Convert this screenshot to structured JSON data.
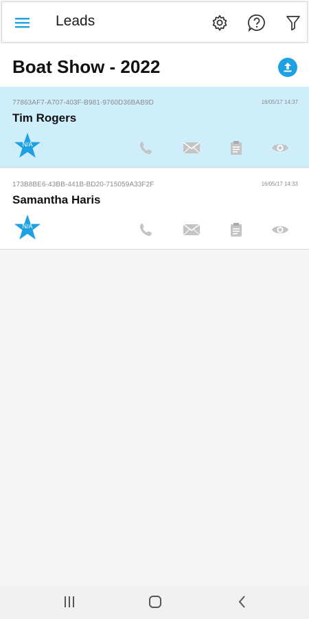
{
  "appbar": {
    "title": "Leads",
    "icons": {
      "menu": "hamburger-menu-icon",
      "settings": "gear-icon",
      "help": "question-bubble-icon",
      "filter": "funnel-icon"
    }
  },
  "event": {
    "title": "Boat Show - 2022",
    "upload_icon": "upload-icon"
  },
  "leads": [
    {
      "id": "77863AF7-A707-403F-B981-9760D36BAB9D",
      "timestamp": "16/05/17 14:37",
      "name": "Tim Rogers",
      "rating": "N/A",
      "selected": true
    },
    {
      "id": "173B8BE6-43BB-441B-BD20-715059A33F2F",
      "timestamp": "16/05/17 14:33",
      "name": "Samantha Haris",
      "rating": "N/A",
      "selected": false
    }
  ],
  "colors": {
    "accent": "#1da1e2",
    "selected_row": "#cfeefc",
    "action_icon": "#c4c4c4"
  },
  "navbar": {
    "icons": [
      "recents-icon",
      "home-icon",
      "back-icon"
    ]
  }
}
